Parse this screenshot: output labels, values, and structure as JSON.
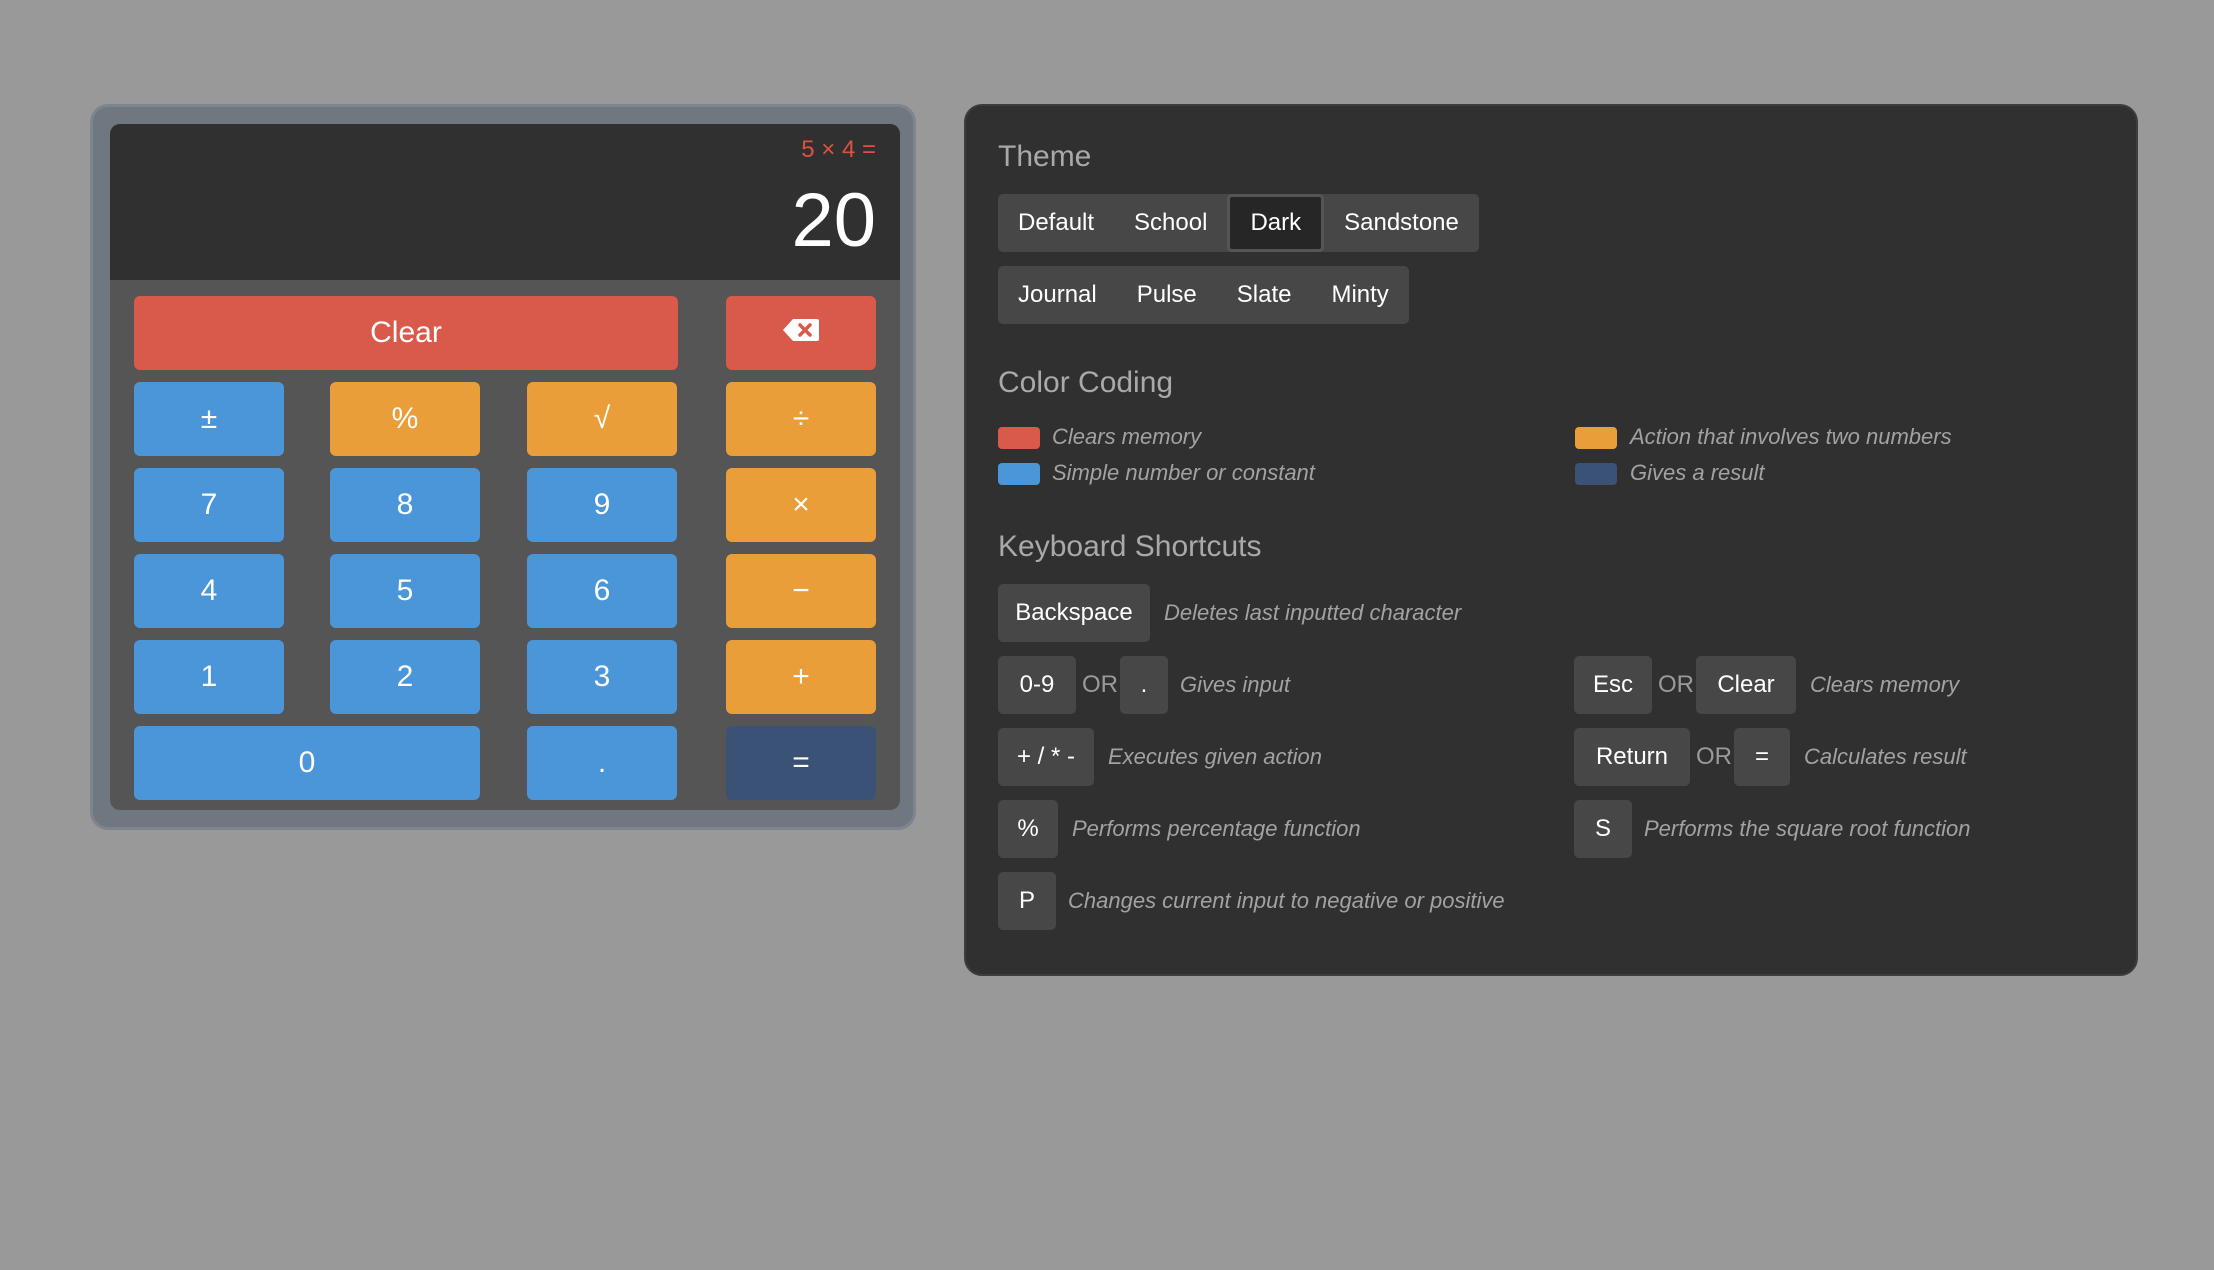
{
  "calculator": {
    "expression": "5 × 4 =",
    "result": "20",
    "buttons": {
      "clear": "Clear",
      "plus_minus": "±",
      "percent": "%",
      "sqrt": "√",
      "divide": "÷",
      "seven": "7",
      "eight": "8",
      "nine": "9",
      "multiply": "×",
      "four": "4",
      "five": "5",
      "six": "6",
      "minus": "−",
      "one": "1",
      "two": "2",
      "three": "3",
      "plus": "+",
      "zero": "0",
      "decimal": ".",
      "equals": "="
    },
    "backspace_icon": "backspace-icon",
    "colors": {
      "red": "#d9594a",
      "blue": "#4b96d8",
      "orange": "#e99e3a",
      "navy": "#3b5277"
    }
  },
  "panel": {
    "theme": {
      "heading": "Theme",
      "row1": [
        "Default",
        "School",
        "Dark",
        "Sandstone"
      ],
      "row2": [
        "Journal",
        "Pulse",
        "Slate",
        "Minty"
      ],
      "selected": "Dark"
    },
    "color_coding": {
      "heading": "Color Coding",
      "items": [
        {
          "label": "Clears memory",
          "color": "#d9594a"
        },
        {
          "label": "Action that involves two numbers",
          "color": "#e99e3a"
        },
        {
          "label": "Simple number or constant",
          "color": "#4b96d8"
        },
        {
          "label": "Gives a result",
          "color": "#3b5277"
        }
      ]
    },
    "shortcuts": {
      "heading": "Keyboard Shortcuts",
      "or_label": "OR",
      "backspace": {
        "key": "Backspace",
        "desc": "Deletes last inputted character"
      },
      "digits": {
        "key": "0-9",
        "alt": ".",
        "desc": "Gives input"
      },
      "clear": {
        "key": "Esc",
        "alt": "Clear",
        "desc": "Clears memory"
      },
      "ops": {
        "key": "+ / * -",
        "desc": "Executes given action"
      },
      "result": {
        "key": "Return",
        "alt": "=",
        "desc": "Calculates result"
      },
      "percent": {
        "key": "%",
        "desc": "Performs percentage function"
      },
      "sqrt": {
        "key": "S",
        "desc": "Performs the square root function"
      },
      "negate": {
        "key": "P",
        "desc": "Changes current input to negative or positive"
      }
    }
  }
}
